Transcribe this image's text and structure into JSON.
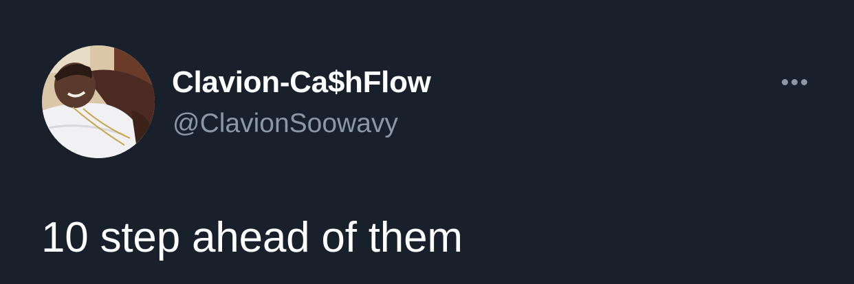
{
  "tweet": {
    "author": {
      "display_name": "Clavion-Ca$hFlow",
      "handle": "@ClavionSoowavy",
      "avatar_icon": "profile-photo"
    },
    "more_icon": "more-horizontal-icon",
    "text": "10 step ahead of them"
  },
  "colors": {
    "background": "#18202c",
    "primary_text": "#ffffff",
    "secondary_text": "#8b98a5"
  }
}
